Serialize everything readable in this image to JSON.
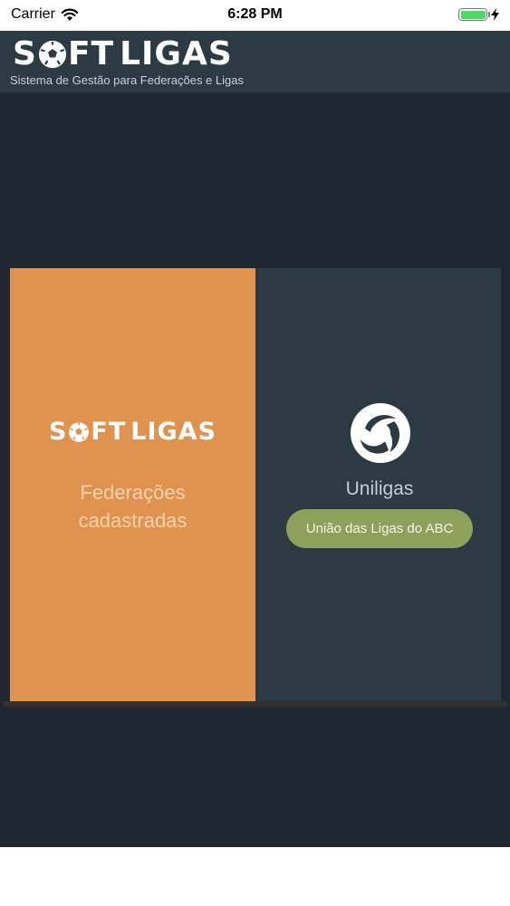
{
  "status_bar": {
    "carrier": "Carrier",
    "time": "6:28 PM"
  },
  "header": {
    "logo_left": "S",
    "logo_mid": "FT",
    "logo_right": "LIGAS",
    "tagline": "Sistema de Gestão para Federações e Ligas"
  },
  "cards": [
    {
      "logo_left": "S",
      "logo_mid": "FT",
      "logo_right": "LIGAS",
      "caption_line1": "Federações",
      "caption_line2": "cadastradas"
    },
    {
      "name": "Uniligas",
      "button_label": "União das Ligas do ABC"
    }
  ],
  "colors": {
    "orange_card": "#e0924f",
    "dark_card": "#2c3a44",
    "background": "#1f2831",
    "button_green": "#8ea15a",
    "battery": "#4cd964"
  },
  "icons": [
    "wifi-icon",
    "battery-icon",
    "charging-bolt-icon",
    "soccer-ball-icon",
    "uniligas-logo-icon"
  ]
}
